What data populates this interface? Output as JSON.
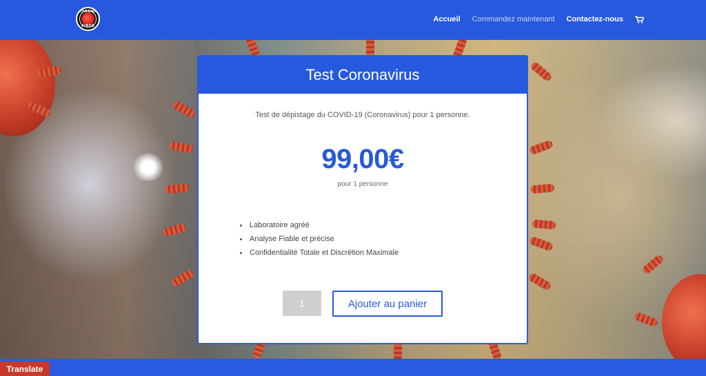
{
  "header": {
    "logo": {
      "icon": "coronavirus-logo-icon",
      "top_text": "CORONA",
      "bottom_text": "VIRUS"
    },
    "nav": [
      {
        "label": "Accueil",
        "active": true
      },
      {
        "label": "Commandez maintenant",
        "active": false
      },
      {
        "label": "Contactez-nous",
        "active": true
      }
    ],
    "cart_icon": "shopping-cart-icon"
  },
  "product": {
    "title": "Test Coronavirus",
    "description": "Test de dépistage du COVID-19 (Coronavirus) pour 1 personne.",
    "price": "99,00€",
    "price_unit": "pour 1 personne",
    "features": [
      "Laboratoire agréé",
      "Analyse Fiable et précise",
      "Confidentialité Totale et Discrétion Maximale"
    ],
    "quantity": "1",
    "add_to_cart_label": "Ajouter au panier"
  },
  "translate_label": "Translate",
  "colors": {
    "brand_blue": "#2659dd",
    "translate_red": "#c73a2a",
    "quantity_gray": "#cfcfcf"
  }
}
